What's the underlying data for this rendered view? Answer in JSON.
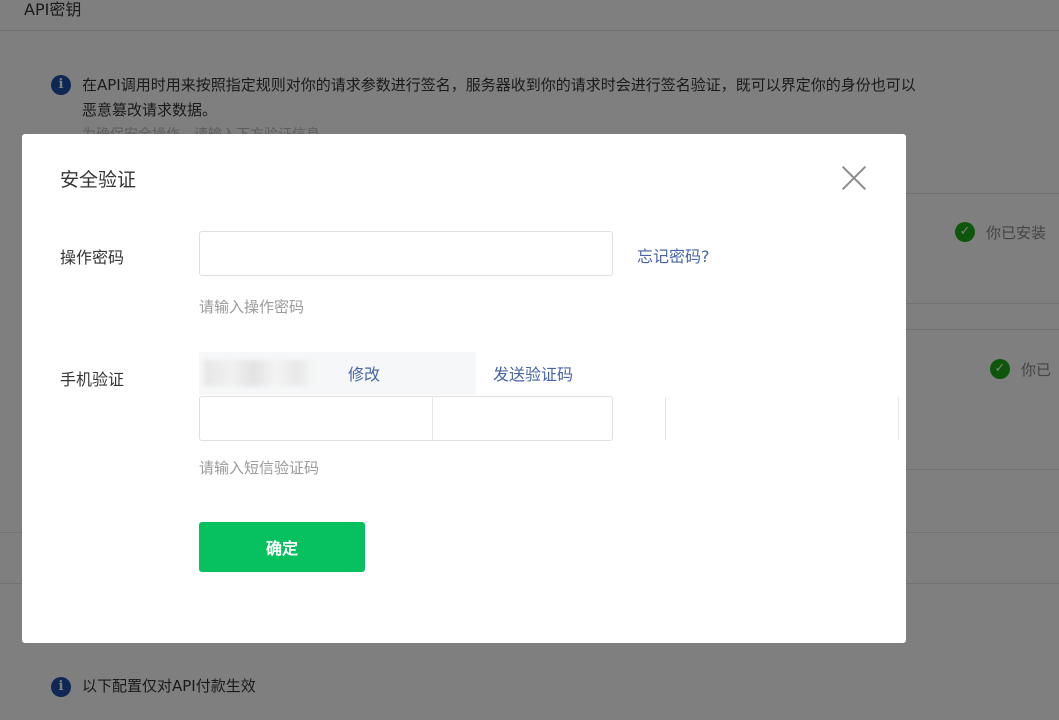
{
  "page": {
    "header_title": "API密钥",
    "notice": {
      "line1": "在API调用时用来按照指定规则对你的请求参数进行签名，服务器收到你的请求时会进行签名验证，既可以界定你的身份也可以",
      "line2": "恶意篡改请求数据。",
      "line3": "为确保安全操作，请输入下方验证信息"
    },
    "status_1": "你已安装",
    "status_2": "你已",
    "footer_notice": "以下配置仅对API付款生效"
  },
  "dialog": {
    "title": "安全验证",
    "password": {
      "label": "操作密码",
      "value": "",
      "placeholder": "",
      "hint": "请输入操作密码",
      "forgot_link": "忘记密码?"
    },
    "phone": {
      "label": "手机验证",
      "edit_link": "修改",
      "send_code_link": "发送验证码",
      "code_digits": [
        "",
        "",
        "",
        "",
        "",
        ""
      ],
      "hint": "请输入短信验证码"
    },
    "confirm_label": "确定"
  },
  "colors": {
    "primary_green": "#07c160",
    "link_blue": "#4864a5",
    "info_blue": "#1d4ea8",
    "check_green": "#1aad19",
    "overlay": "rgba(0,0,0,0.5)"
  },
  "icons": {
    "info": "info-icon",
    "check": "check-circle-icon",
    "close": "close-icon"
  }
}
